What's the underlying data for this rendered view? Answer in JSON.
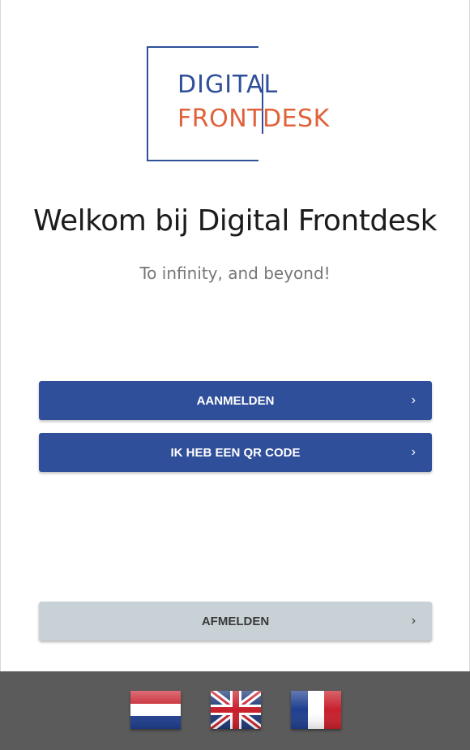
{
  "logo": {
    "line1": "DIGITAL",
    "line2": "FRONTDESK",
    "colors": {
      "blue": "#2f4f9a",
      "orange": "#e0623a"
    }
  },
  "welcome": {
    "title": "Welkom bij Digital Frontdesk",
    "subtitle": "To infinity, and beyond!"
  },
  "actions": {
    "aanmelden": {
      "label": "AANMELDEN",
      "icon": "chevron-right-icon"
    },
    "qr_code": {
      "label": "IK HEB EEN QR CODE",
      "icon": "chevron-right-icon"
    },
    "afmelden": {
      "label": "AFMELDEN",
      "icon": "chevron-right-icon"
    },
    "chevron": "›"
  },
  "languages": [
    {
      "code": "nl",
      "icon": "dutch-flag-icon"
    },
    {
      "code": "en",
      "icon": "uk-flag-icon"
    },
    {
      "code": "fr",
      "icon": "french-flag-icon"
    }
  ],
  "colors": {
    "primary": "#2f4f9a",
    "secondary": "#c8d1d6",
    "footer": "#5b5b5b"
  }
}
